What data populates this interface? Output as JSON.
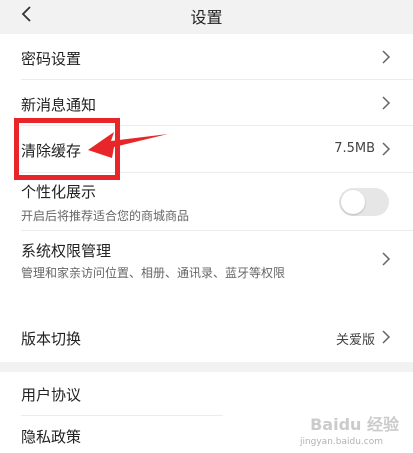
{
  "header": {
    "title": "设置"
  },
  "rows": {
    "password": {
      "label": "密码设置"
    },
    "notifications": {
      "label": "新消息通知"
    },
    "clear_cache": {
      "label": "清除缓存",
      "value": "7.5MB"
    },
    "personalized": {
      "label": "个性化展示",
      "subtitle": "开启后将推荐适合您的商城商品",
      "enabled": false
    },
    "permissions": {
      "label": "系统权限管理",
      "subtitle": "管理和家亲访问位置、相册、通讯录、蓝牙等权限"
    },
    "version": {
      "label": "版本切换",
      "value": "关爱版"
    },
    "user_agreement": {
      "label": "用户协议"
    },
    "privacy": {
      "label": "隐私政策"
    }
  },
  "annotation": {
    "color": "#e8262a"
  },
  "watermark": {
    "logo": "Baidu 经验",
    "url": "jingyan.baidu.com"
  },
  "colors": {
    "background": "#f2f2f2",
    "card": "#ffffff",
    "accent": "#e8262a"
  }
}
